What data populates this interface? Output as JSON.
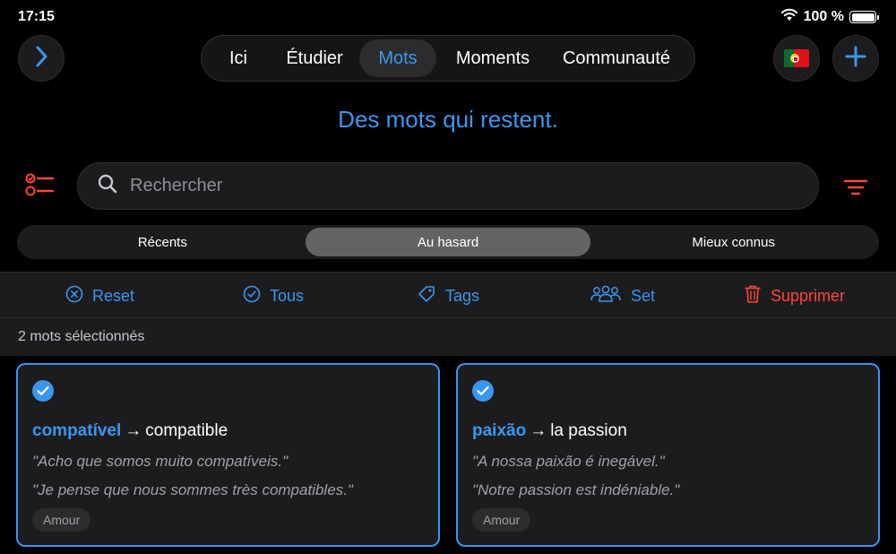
{
  "status": {
    "time": "17:15",
    "battery": "100 %",
    "battery_level": 1.0
  },
  "nav": {
    "tabs": [
      {
        "label": "Ici",
        "active": false
      },
      {
        "label": "Étudier",
        "active": false
      },
      {
        "label": "Mots",
        "active": true
      },
      {
        "label": "Moments",
        "active": false
      },
      {
        "label": "Communauté",
        "active": false
      }
    ]
  },
  "headline": "Des mots qui restent.",
  "search": {
    "placeholder": "Rechercher",
    "value": ""
  },
  "segments": [
    {
      "label": "Récents",
      "active": false
    },
    {
      "label": "Au hasard",
      "active": true
    },
    {
      "label": "Mieux connus",
      "active": false
    }
  ],
  "actions": {
    "reset": "Reset",
    "all": "Tous",
    "tags": "Tags",
    "set": "Set",
    "delete": "Supprimer"
  },
  "selection": {
    "text": "2 mots sélectionnés"
  },
  "cards": [
    {
      "word": "compatível",
      "arrow": "→",
      "translation": "compatible",
      "example_pt": "\"Acho que somos muito compatíveis.\"",
      "example_fr": "\"Je pense que nous sommes très compatibles.\"",
      "tag": "Amour"
    },
    {
      "word": "paixão",
      "arrow": "→",
      "translation": "la passion",
      "example_pt": "\"A nossa paixão é inegável.\"",
      "example_fr": "\"Notre passion est indéniable.\"",
      "tag": "Amour"
    }
  ],
  "colors": {
    "accent": "#3a97f0",
    "danger": "#ff453a",
    "background": "#000000",
    "surface": "#1c1c1e"
  },
  "icons": {
    "back": "chevron-right-icon",
    "flag": "portugal-flag-icon",
    "add": "plus-icon",
    "filter": "checklist-icon",
    "search": "search-icon",
    "sort": "sort-lines-icon"
  }
}
